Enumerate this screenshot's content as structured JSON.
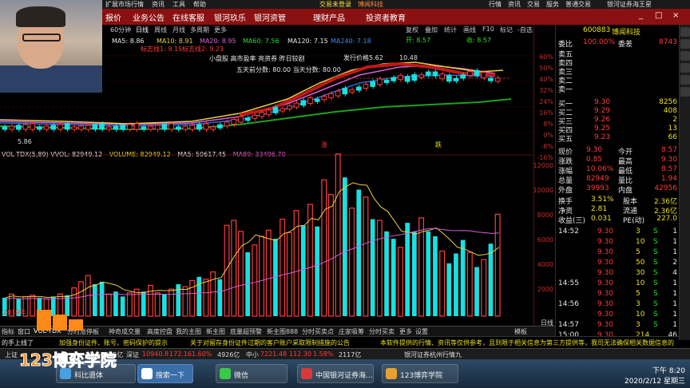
{
  "window": {
    "title_left": "扩展市场行情",
    "title_menu": [
      "资讯",
      "工具",
      "帮助"
    ],
    "title_center": "交易未登录",
    "title_stock": "博闻科技",
    "title_right": [
      "行情",
      "资讯",
      "交易",
      "服务",
      "普通交易"
    ],
    "title_app": "银河证券海王星"
  },
  "menu": {
    "items": [
      "报价",
      "业务公告",
      "在线客服",
      "银河玖乐",
      "银河资管"
    ],
    "right_items": [
      "理财产品",
      "投资者教育"
    ],
    "window_controls": [
      "_",
      "□",
      "×"
    ]
  },
  "chart_toolbar": {
    "periods": [
      "60分钟",
      "日线",
      "周线",
      "月线",
      "多周期",
      "更多"
    ],
    "actions": [
      "复权",
      "叠加",
      "统计",
      "画线",
      "F10",
      "标记",
      "-自选",
      "返回"
    ]
  },
  "kline": {
    "ma_line": {
      "ma5": "MA5: 8.86",
      "ma10": "MA10: 8.91",
      "ma20": "MA20: 8.95",
      "ma60": "MA60: 7.56",
      "ma120": "MA120: 7.15",
      "ma240": "MA240: 7.18"
    },
    "signal_line": {
      "a": "标志线1: 9.15",
      "b": "标志线2: 9.23"
    },
    "notes": {
      "info": "小盘股 高市盈率 亮资券 昨日较剧",
      "wuhua": "五天前分数: 80.00  当天分数: 80.00",
      "issue_price": "发行价格5.62",
      "high": "10.48",
      "low": "5.86",
      "open_label": "开: 8.57",
      "close_label": "收: 8.57"
    },
    "right_axis": [
      "60%",
      "50%",
      "40%",
      "32%",
      "24%",
      "16%",
      "8%",
      "0%",
      "-8%",
      "-16%"
    ],
    "markers": [
      "涨",
      "跌"
    ]
  },
  "volume": {
    "header": {
      "name": "VOL-TDX(5,89)",
      "vvol": "VVOL: 82949.12",
      "volume": "VOLUME: 82949.12",
      "ma5": "MA5: 50617.45",
      "ma89": "MA89: 33496.70"
    },
    "axis": [
      "12000",
      "10000",
      "8000",
      "6000",
      "4000",
      "2000"
    ],
    "axis_unit": "日线",
    "year_label": "2019年"
  },
  "chart_data": {
    "type": "bar",
    "title": "",
    "xlabel": "",
    "ylabel": "",
    "ylim": [
      0,
      13000
    ],
    "series": [
      {
        "values": [
          1500,
          1800,
          1400,
          1600,
          1700,
          1500,
          1400,
          1600,
          1800,
          1700,
          2300,
          2800,
          3300,
          2600,
          2800,
          1800,
          2000,
          1600,
          1900,
          2200,
          2000,
          2500,
          1900,
          1800,
          2200,
          2600,
          2400,
          2900,
          3200,
          3000,
          3600,
          3000,
          7400,
          7800,
          6900,
          5200,
          5800,
          6500,
          7000,
          6300,
          7900,
          6800,
          8600,
          7400,
          9100,
          7300,
          11100,
          9900,
          13200,
          11300,
          8800,
          10300,
          9700,
          7900,
          7800,
          6900,
          6300,
          5600,
          7600,
          6900,
          8000,
          6900,
          6500,
          5300,
          4300,
          5100,
          6200,
          5200,
          4000,
          4600,
          5900,
          8300
        ],
        "up": [
          0,
          1,
          0,
          1,
          1,
          0,
          1,
          0,
          1,
          0,
          1,
          1,
          1,
          0,
          0,
          1,
          0,
          0,
          1,
          1,
          0,
          1,
          1,
          0,
          1,
          0,
          1,
          1,
          0,
          1,
          1,
          0,
          1,
          1,
          1,
          0,
          1,
          1,
          1,
          0,
          1,
          1,
          1,
          0,
          1,
          0,
          1,
          1,
          1,
          0,
          1,
          0,
          1,
          0,
          1,
          0,
          0,
          1,
          0,
          0,
          1,
          0,
          0,
          1,
          0,
          0,
          0,
          1,
          0,
          1,
          0,
          1
        ]
      }
    ]
  },
  "quote": {
    "code": "600883",
    "name": "博闻科技",
    "weibi_label": "委比",
    "weibi": "100.00%",
    "weicha_label": "委差",
    "weicha": "8743",
    "sell": [
      {
        "label": "卖五",
        "price": "",
        "vol": ""
      },
      {
        "label": "卖四",
        "price": "",
        "vol": ""
      },
      {
        "label": "卖三",
        "price": "",
        "vol": ""
      },
      {
        "label": "卖二",
        "price": "",
        "vol": ""
      },
      {
        "label": "卖一",
        "price": "",
        "vol": ""
      }
    ],
    "buy": [
      {
        "label": "买一",
        "price": "9.30",
        "vol": "8256"
      },
      {
        "label": "买二",
        "price": "9.29",
        "vol": "408"
      },
      {
        "label": "买三",
        "price": "9.26",
        "vol": "2"
      },
      {
        "label": "买四",
        "price": "9.25",
        "vol": "13"
      },
      {
        "label": "买五",
        "price": "9.23",
        "vol": "66"
      }
    ],
    "stats": [
      {
        "l1": "现价",
        "v1": "9.30",
        "l2": "今开",
        "v2": "8.57"
      },
      {
        "l1": "涨跌",
        "v1": "0.85",
        "l2": "最高",
        "v2": "9.30"
      },
      {
        "l1": "涨幅",
        "v1": "10.06%",
        "l2": "最低",
        "v2": "8.57"
      },
      {
        "l1": "总量",
        "v1": "82949",
        "l2": "量比",
        "v2": "1.94"
      },
      {
        "l1": "外盘",
        "v1": "39993",
        "l2": "内盘",
        "v2": "42956"
      }
    ],
    "stats2": [
      {
        "l1": "换手",
        "v1": "3.51%",
        "l2": "股本",
        "v2": "2.36亿"
      },
      {
        "l1": "净资",
        "v1": "2.81",
        "l2": "流通",
        "v2": "2.36亿"
      },
      {
        "l1": "收益(三)",
        "v1": "0.031",
        "l2": "PE(动)",
        "v2": "227.0"
      }
    ],
    "ticks": [
      {
        "t": "14:52",
        "p": "9.30",
        "v": "3",
        "s": "S",
        "n": "1"
      },
      {
        "t": "",
        "p": "9.30",
        "v": "10",
        "s": "S",
        "n": "1"
      },
      {
        "t": "",
        "p": "9.30",
        "v": "5",
        "s": "S",
        "n": "1"
      },
      {
        "t": "",
        "p": "9.30",
        "v": "50",
        "s": "S",
        "n": "2"
      },
      {
        "t": "",
        "p": "9.30",
        "v": "30",
        "s": "S",
        "n": "4"
      },
      {
        "t": "14:55",
        "p": "9.30",
        "v": "10",
        "s": "S",
        "n": "1"
      },
      {
        "t": "",
        "p": "9.30",
        "v": "5",
        "s": "S",
        "n": "1"
      },
      {
        "t": "14:56",
        "p": "9.30",
        "v": "3",
        "s": "S",
        "n": "1"
      },
      {
        "t": "",
        "p": "9.30",
        "v": "10",
        "s": "S",
        "n": "1"
      },
      {
        "t": "14:57",
        "p": "9.30",
        "v": "3",
        "s": "S",
        "n": "1"
      },
      {
        "t": "15:00",
        "p": "9.30",
        "v": "214",
        "s": "",
        "n": "46"
      }
    ]
  },
  "tabs": {
    "items": [
      "指标",
      "窗口",
      "VOL-TDX",
      "分时涨停板",
      "神奇成交量",
      "高度控盘",
      "我的主图",
      "新主图",
      "底量超预警",
      "新主图888",
      "分时买卖点",
      "庄家吸筹",
      "分时买卖",
      "更多",
      "设置"
    ],
    "right": "模板"
  },
  "ticker": {
    "left": "的手上线了",
    "item1": "加强身份证件、账号、密码保护的提示",
    "item2": "关于对留存身份证件过期的客户账户采取限制措施的公告",
    "item3": "本软件提供的行情、资讯等仅供参考，且到限于相关信息为第三方提供等，我司无法确保相关数据信息的"
  },
  "status": {
    "sh": "上证",
    "sz_amount": "2975亿",
    "sz_label": "深证",
    "sz_value": "10940.8",
    "sz_chg": "172.16",
    "sz_pct": "1.60%",
    "sz_amt": "4926亿",
    "zx_label": "中小",
    "zx_value": "7221.48",
    "zx_chg": "112.30",
    "zx_pct": "1.58%",
    "zx_amt": "2117亿",
    "server": "银河证券杭州行情九"
  },
  "taskbar": {
    "tasks": [
      "科比遗体",
      "搜索一下",
      "微信",
      "中国银河证券海...",
      "123博弈学院"
    ],
    "time": "下午 8:20",
    "date": "2020/2/12 星期三"
  },
  "logo": {
    "text": "123博弈学院"
  },
  "colors": {
    "up": "#ff3b3b",
    "down": "#19e0e0",
    "bg": "#000000",
    "menu": "#8a1111"
  }
}
